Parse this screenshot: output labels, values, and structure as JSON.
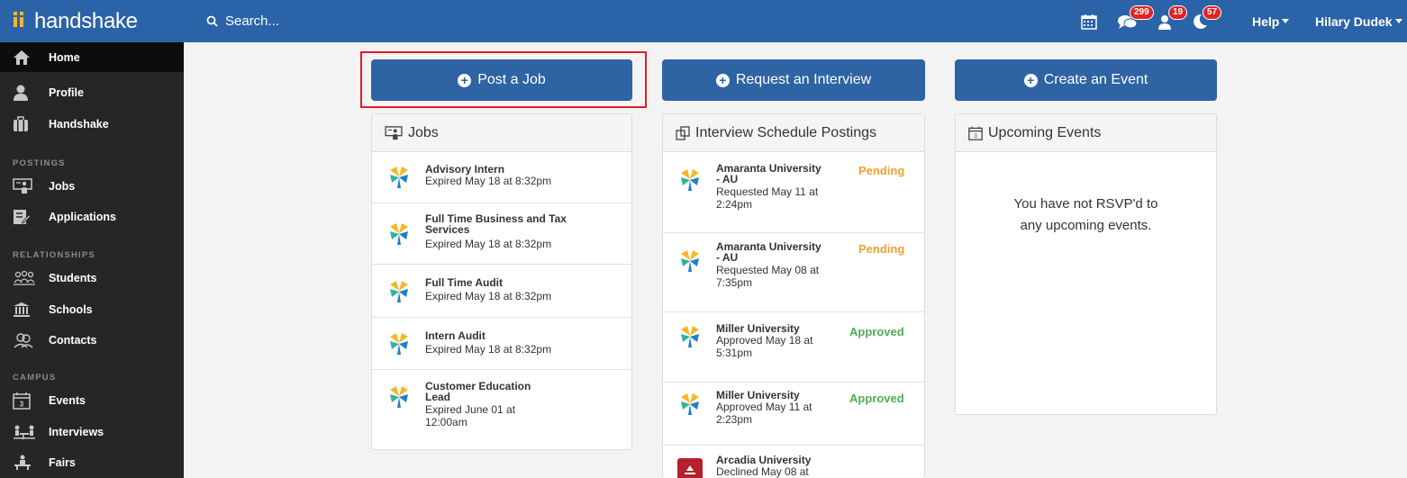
{
  "header": {
    "logo_text": "handshake",
    "search_label": "Search...",
    "notifications": [
      {
        "icon": "chat-bubbles-icon",
        "count": "299"
      },
      {
        "icon": "person-icon",
        "count": "19"
      },
      {
        "icon": "moon-icon",
        "count": "57"
      }
    ],
    "help_label": "Help",
    "user_name": "Hilary Dudek"
  },
  "sidebar": {
    "items": [
      {
        "label": "Home",
        "icon": "home-icon",
        "active": true
      },
      {
        "label": "Profile",
        "icon": "person-icon"
      },
      {
        "label": "Handshake",
        "icon": "briefcase-icon"
      }
    ],
    "sections": [
      {
        "heading": "POSTINGS",
        "items": [
          {
            "label": "Jobs",
            "icon": "jobs-icon"
          },
          {
            "label": "Applications",
            "icon": "applications-icon"
          }
        ]
      },
      {
        "heading": "RELATIONSHIPS",
        "items": [
          {
            "label": "Students",
            "icon": "students-icon"
          },
          {
            "label": "Schools",
            "icon": "school-icon"
          },
          {
            "label": "Contacts",
            "icon": "contacts-icon"
          }
        ]
      },
      {
        "heading": "CAMPUS",
        "items": [
          {
            "label": "Events",
            "icon": "calendar-icon"
          },
          {
            "label": "Interviews",
            "icon": "interviews-icon"
          },
          {
            "label": "Fairs",
            "icon": "fairs-icon"
          }
        ]
      }
    ]
  },
  "actions": {
    "post_job": "Post a Job",
    "request_interview": "Request an Interview",
    "create_event": "Create an Event"
  },
  "jobs": {
    "title": "Jobs",
    "items": [
      {
        "title": "Advisory Intern",
        "sub": "Expired May 18 at 8:32pm"
      },
      {
        "title": "Full Time Business and Tax Services",
        "sub": "Expired May 18 at 8:32pm"
      },
      {
        "title": "Full Time Audit",
        "sub": "Expired May 18 at 8:32pm"
      },
      {
        "title": "Intern Audit",
        "sub": "Expired May 18 at 8:32pm"
      },
      {
        "title": "Customer Education Lead",
        "sub": "Expired June 01 at 12:00am"
      }
    ]
  },
  "interviews": {
    "title": "Interview Schedule Postings",
    "items": [
      {
        "school": "Amaranta University - AU",
        "sub": "Requested May 11 at 2:24pm",
        "status": "Pending"
      },
      {
        "school": "Amaranta University - AU",
        "sub": "Requested May 08 at 7:35pm",
        "status": "Pending"
      },
      {
        "school": "Miller University",
        "sub": "Approved May 18 at 5:31pm",
        "status": "Approved"
      },
      {
        "school": "Miller University",
        "sub": "Approved May 11 at 2:23pm",
        "status": "Approved"
      },
      {
        "school": "Arcadia University",
        "sub": "Declined May 08 at",
        "status": ""
      }
    ]
  },
  "events": {
    "title": "Upcoming Events",
    "empty": "You have not RSVP'd to any upcoming events."
  },
  "colors": {
    "brand_blue": "#2b63a8",
    "pending": "#f0a030",
    "approved": "#4caf50",
    "highlight": "#e01e1e"
  }
}
